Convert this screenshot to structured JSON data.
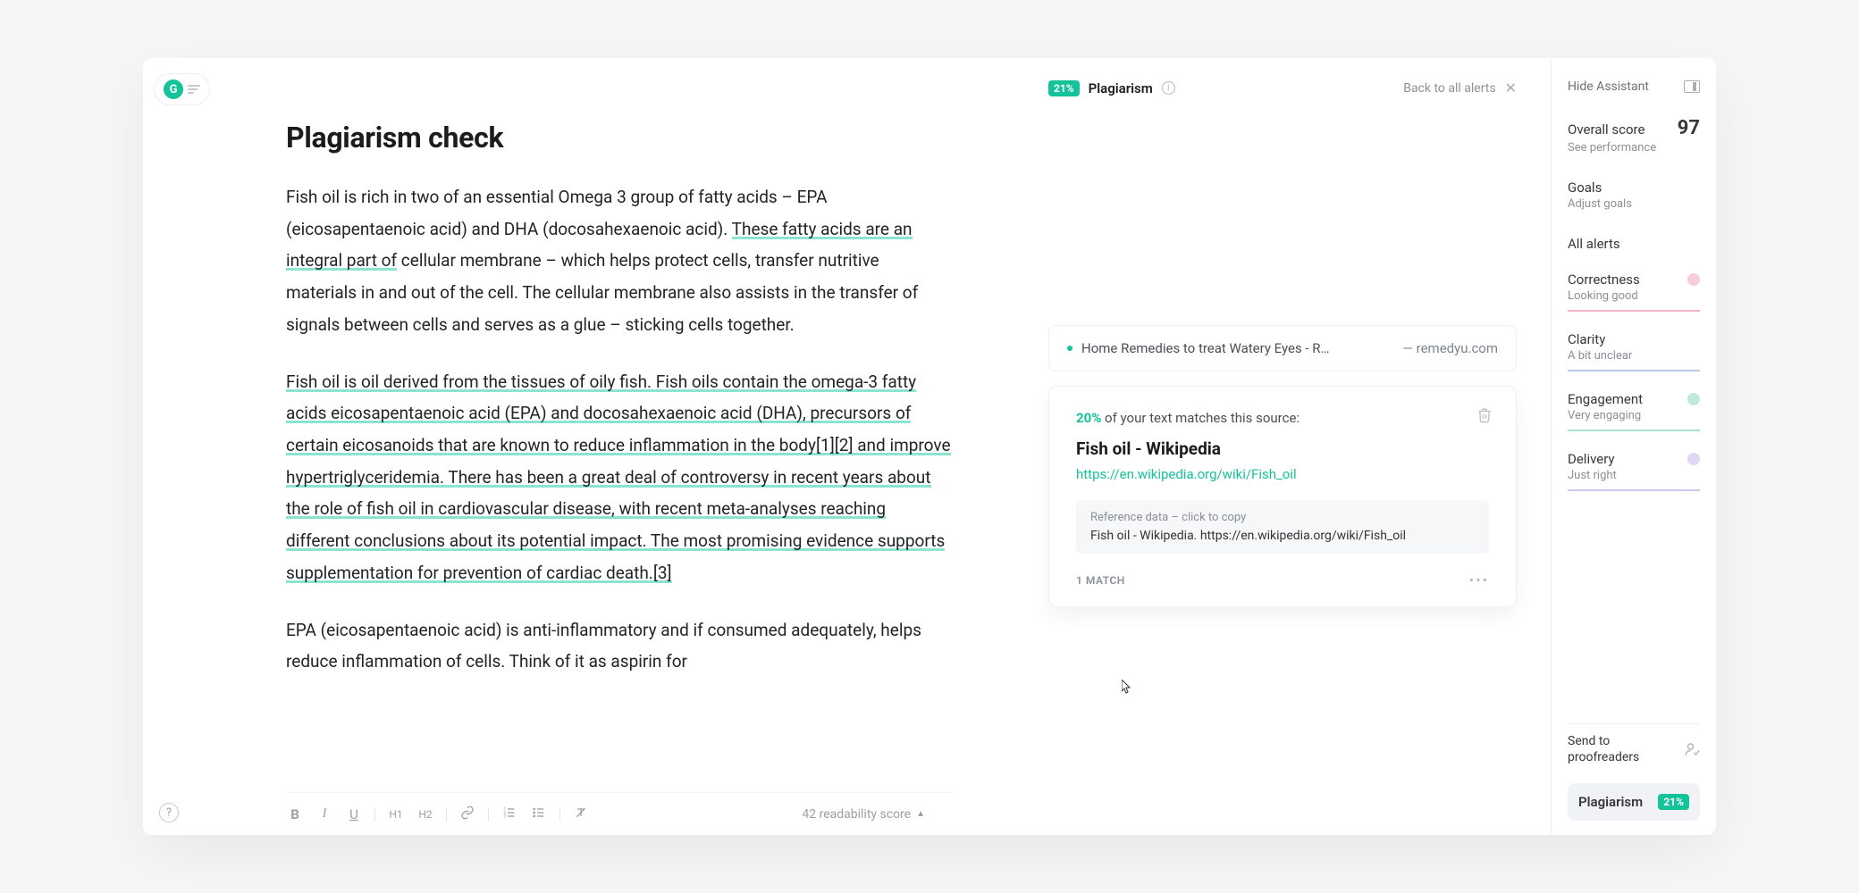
{
  "header": {
    "badge_pct": "21%",
    "label": "Plagiarism",
    "back_link": "Back to all alerts"
  },
  "editor": {
    "title": "Plagiarism check",
    "p1a": "Fish oil is rich in two of an essential Omega 3 group of fatty acids – EPA (eicosapentaenoic acid) and DHA (docosahexaenoic acid). ",
    "p1b": "These fatty acids are an integral part of",
    "p1c": " cellular membrane – which helps protect cells, transfer nutritive materials in and out of the cell. The cellular membrane also assists in the transfer of signals between cells and serves as a glue – sticking cells together.",
    "p2": "Fish oil is oil derived from the tissues of oily fish. Fish oils contain the omega-3 fatty acids eicosapentaenoic acid (EPA) and docosahexaenoic acid (DHA), precursors of certain eicosanoids that are known to reduce inflammation in the body[1][2] and improve hypertriglyceridemia. There has been a great deal of controversy in recent years about the role of fish oil in cardiovascular disease, with recent meta-analyses reaching different conclusions about its potential impact. The most promising evidence supports supplementation for prevention of cardiac death.[3]",
    "p3": "EPA (eicosapentaenoic acid) is anti-inflammatory and if consumed adequately, helps reduce inflammation of cells. Think of it as aspirin for",
    "readability": "42 readability score"
  },
  "source_row": {
    "title": "Home Remedies to treat Watery Eyes - R…",
    "domain": "— remedyu.com"
  },
  "card": {
    "pct": "20%",
    "pct_suffix": " of your text matches this source:",
    "title": "Fish oil - Wikipedia",
    "url": "https://en.wikipedia.org/wiki/Fish_oil",
    "ref_label": "Reference data – click to copy",
    "ref_text": "Fish oil - Wikipedia. https://en.wikipedia.org/wiki/Fish_oil",
    "match_count": "1 MATCH"
  },
  "assistant": {
    "hide": "Hide Assistant",
    "score_label": "Overall score",
    "score": "97",
    "see_perf": "See performance",
    "goals": "Goals",
    "adjust_goals": "Adjust goals",
    "all_alerts": "All alerts",
    "correctness": {
      "t": "Correctness",
      "s": "Looking good"
    },
    "clarity": {
      "t": "Clarity",
      "s": "A bit unclear"
    },
    "engagement": {
      "t": "Engagement",
      "s": "Very engaging"
    },
    "delivery": {
      "t": "Delivery",
      "s": "Just right"
    },
    "proofreaders": "Send to\nproofreaders",
    "plag_label": "Plagiarism",
    "plag_pct": "21%"
  },
  "toolbar": {
    "bold": "B",
    "italic": "I",
    "underline": "U",
    "h1": "H1",
    "h2": "H2"
  }
}
